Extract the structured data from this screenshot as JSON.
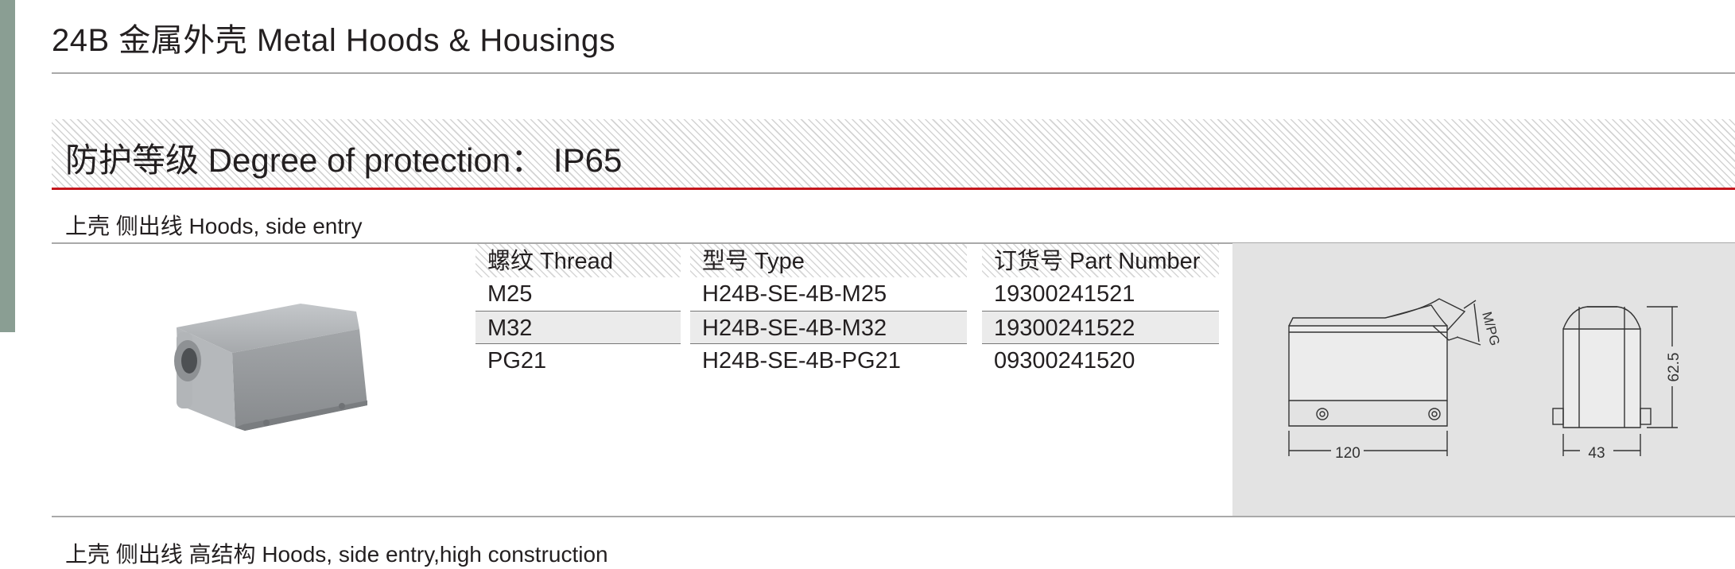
{
  "page": {
    "title": "24B 金属外壳  Metal Hoods & Housings"
  },
  "protection": {
    "label": "防护等级 Degree of protection： IP65"
  },
  "section1": {
    "title": "上壳 侧出线  Hoods, side entry",
    "table": {
      "headers": [
        "螺纹 Thread",
        "型号 Type",
        "订货号 Part Number"
      ],
      "rows": [
        [
          "M25",
          "H24B-SE-4B-M25",
          "19300241521"
        ],
        [
          "M32",
          "H24B-SE-4B-M32",
          "19300241522"
        ],
        [
          "PG21",
          "H24B-SE-4B-PG21",
          "09300241520"
        ]
      ]
    },
    "drawing": {
      "dim_length": "120",
      "dim_height": "62.5",
      "dim_width": "43",
      "thread_label": "M/PG"
    }
  },
  "section2": {
    "title": "上壳 侧出线 高结构  Hoods, side entry,high construction"
  },
  "colors": {
    "accent_red": "#c4161c",
    "side_tab": "#8a9e93",
    "drawing_bg": "#e3e3e3",
    "housing_gray": "#9fa2a5"
  }
}
